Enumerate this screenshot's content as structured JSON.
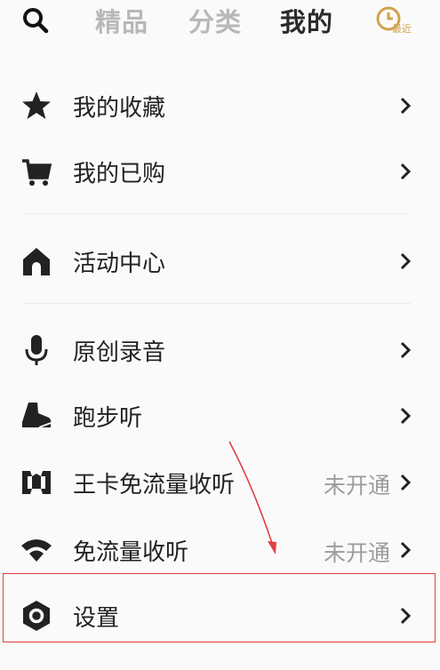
{
  "header": {
    "tabs": [
      "精品",
      "分类",
      "我的"
    ],
    "active_tab": 2,
    "recent_label": "最近",
    "search_icon": "search-icon",
    "recent_icon": "clock-icon"
  },
  "menu": [
    {
      "label": "我的收藏",
      "icon": "star-icon"
    },
    {
      "label": "我的已购",
      "icon": "cart-icon"
    },
    {
      "label": "活动中心",
      "icon": "home-icon"
    },
    {
      "label": "原创录音",
      "icon": "microphone-icon"
    },
    {
      "label": "跑步听",
      "icon": "shoe-icon"
    },
    {
      "label": "王卡免流量收听",
      "icon": "wangka-icon",
      "status": "未开通"
    },
    {
      "label": "免流量收听",
      "icon": "wifi-icon",
      "status": "未开通"
    },
    {
      "label": "设置",
      "icon": "settings-icon"
    }
  ],
  "colors": {
    "accent": "#d2a24c",
    "highlight_box": "#e04040",
    "arrow": "#e04040"
  }
}
